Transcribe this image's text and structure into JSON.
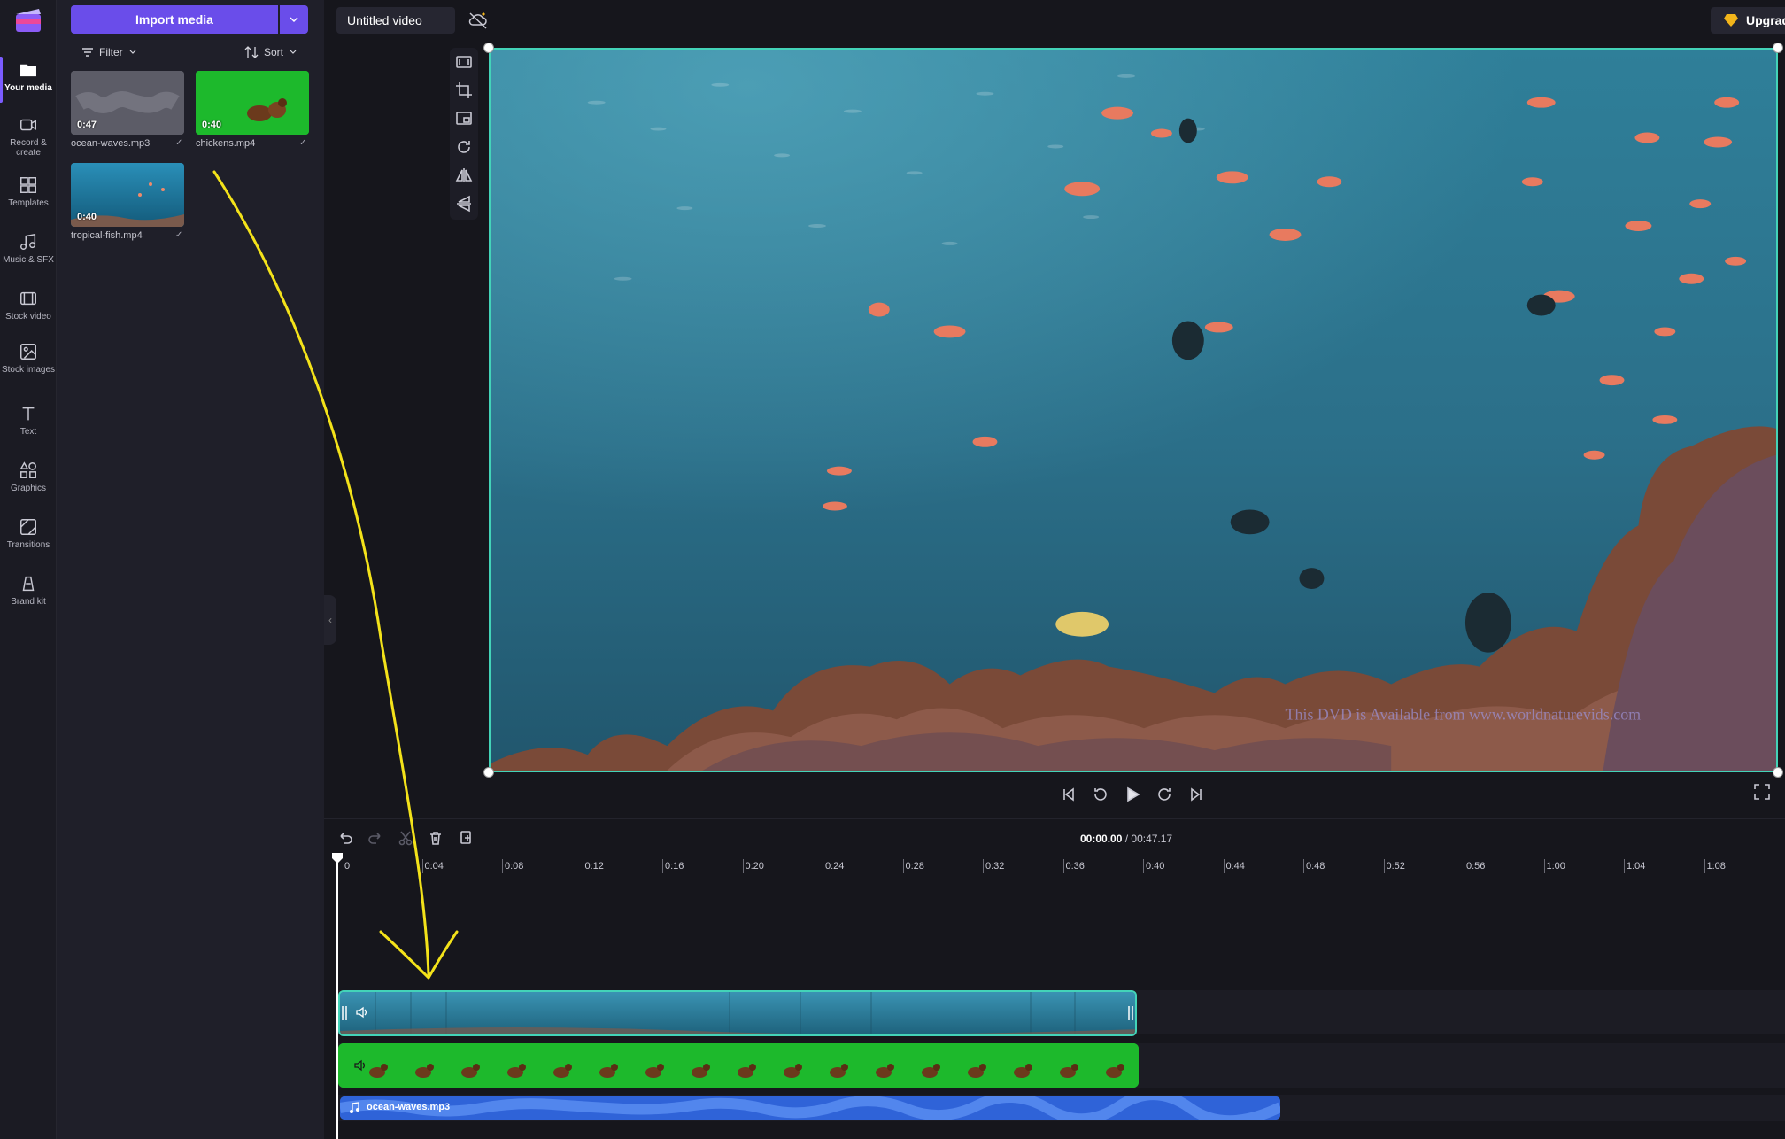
{
  "rail": {
    "items": [
      {
        "label": "Your media",
        "icon": "folder-icon"
      },
      {
        "label": "Record & create",
        "icon": "camera-icon"
      },
      {
        "label": "Templates",
        "icon": "templates-icon"
      },
      {
        "label": "Music & SFX",
        "icon": "music-note-icon"
      },
      {
        "label": "Stock video",
        "icon": "film-icon"
      },
      {
        "label": "Stock images",
        "icon": "image-icon"
      },
      {
        "label": "Text",
        "icon": "text-icon"
      },
      {
        "label": "Graphics",
        "icon": "shapes-icon"
      },
      {
        "label": "Transitions",
        "icon": "transitions-icon"
      },
      {
        "label": "Brand kit",
        "icon": "brand-kit-icon"
      }
    ]
  },
  "panel": {
    "import_label": "Import media",
    "filter_label": "Filter",
    "sort_label": "Sort",
    "media": [
      {
        "name": "ocean-waves.mp3",
        "duration": "0:47"
      },
      {
        "name": "chickens.mp4",
        "duration": "0:40"
      },
      {
        "name": "tropical-fish.mp4",
        "duration": "0:40"
      }
    ]
  },
  "topbar": {
    "project_title": "Untitled video",
    "upgrade_label": "Upgrade"
  },
  "timeline": {
    "current_time": "00:00.00",
    "separator": " / ",
    "total_time": "00:47.17",
    "ticks": [
      "0",
      "0:04",
      "0:08",
      "0:12",
      "0:16",
      "0:20",
      "0:24",
      "0:28",
      "0:32",
      "0:36",
      "0:40",
      "0:44",
      "0:48",
      "0:52",
      "0:56",
      "1:00",
      "1:04",
      "1:08"
    ],
    "audio_clip_label": "ocean-waves.mp3"
  },
  "colors": {
    "accent": "#6a4dea",
    "selection": "#43d3b8",
    "green_screen": "#1db92c",
    "audio_clip": "#2f63d8",
    "annotation": "#f3e21a"
  }
}
